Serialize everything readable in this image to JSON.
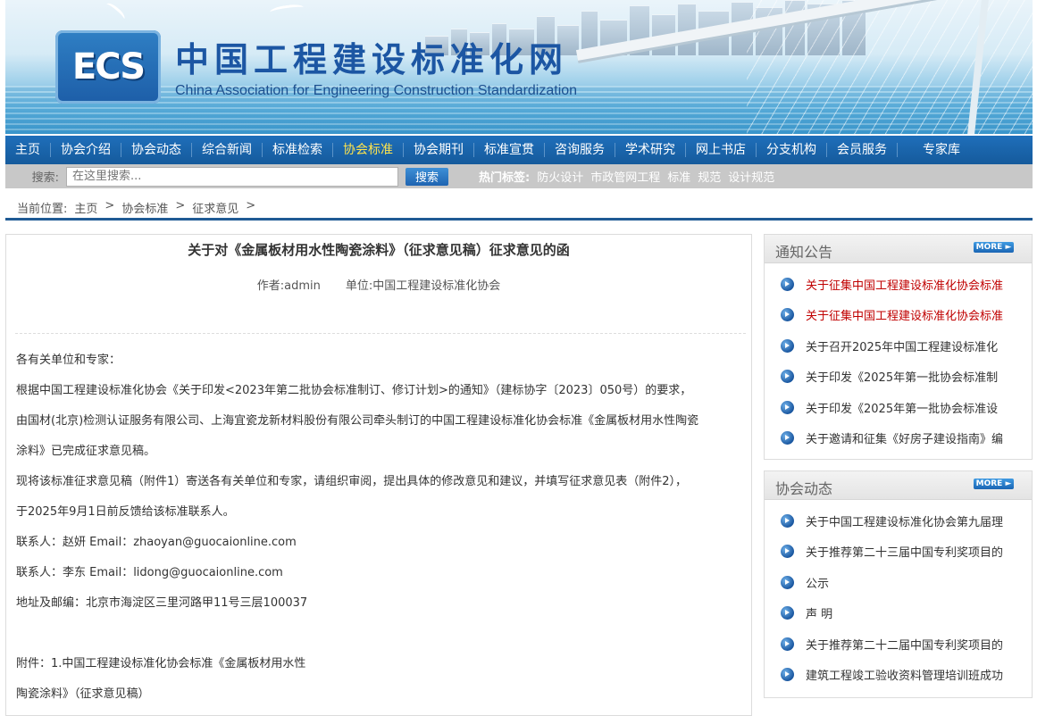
{
  "header": {
    "logo_text": "ECS",
    "site_title": "中国工程建设标准化网",
    "site_subtitle": "China Association for Engineering Construction Standardization"
  },
  "nav": [
    "主页",
    "协会介绍",
    "协会动态",
    "综合新闻",
    "标准检索",
    "协会标准",
    "协会期刊",
    "标准宣贯",
    "咨询服务",
    "学术研究",
    "网上书店",
    "分支机构",
    "会员服务",
    "专家库"
  ],
  "search": {
    "label": "搜索:",
    "placeholder": "在这里搜索...",
    "button": "搜索",
    "hot_label": "热门标签:",
    "hot_tags": [
      "防火设计",
      "市政管网工程",
      "标准",
      "规范",
      "设计规范"
    ]
  },
  "breadcrumb": [
    "当前位置:",
    "主页",
    ">",
    "协会标准",
    ">",
    "征求意见",
    ">"
  ],
  "article": {
    "title": "关于对《金属板材用水性陶瓷涂料》（征求意见稿）征求意见的函",
    "author": "作者:admin",
    "unit": "单位:中国工程建设标准化协会",
    "paragraphs": [
      "各有关单位和专家：",
      "根据中国工程建设标准化协会《关于印发<2023年第二批协会标准制订、修订计划>的通知》（建标协字〔2023〕050号）的要求，",
      "由国材(北京)检测认证服务有限公司、上海宜瓷龙新材料股份有限公司牵头制订的中国工程建设标准化协会标准《金属板材用水性陶瓷",
      "涂料》已完成征求意见稿。",
      "现将该标准征求意见稿（附件1）寄送各有关单位和专家，请组织审阅，提出具体的修改意见和建议，并填写征求意见表（附件2），",
      "于2025年9月1日前反馈给该标准联系人。",
      "联系人：赵妍 Email：zhaoyan@guocaionline.com",
      "联系人：李东  Email：lidong@guocaionline.com",
      "地址及邮编：北京市海淀区三里河路甲11号三层100037",
      "",
      "附件：1.中国工程建设标准化协会标准《金属板材用水性",
      "陶瓷涂料》（征求意见稿）"
    ]
  },
  "sidebar": {
    "notice": {
      "title": "通知公告",
      "more": "MORE",
      "items": [
        {
          "text": "关于征集中国工程建设标准化协会标准",
          "color": "#c00000"
        },
        {
          "text": "关于征集中国工程建设标准化协会标准",
          "color": "#c00000"
        },
        {
          "text": "关于召开2025年中国工程建设标准化",
          "color": "#333333"
        },
        {
          "text": "关于印发《2025年第一批协会标准制",
          "color": "#333333"
        },
        {
          "text": "关于印发《2025年第一批协会标准设",
          "color": "#333333"
        },
        {
          "text": "关于邀请和征集《好房子建设指南》编",
          "color": "#333333"
        }
      ]
    },
    "news": {
      "title": "协会动态",
      "more": "MORE",
      "items": [
        {
          "text": "关于中国工程建设标准化协会第九届理",
          "icon": true
        },
        {
          "text": "关于推荐第二十三届中国专利奖项目的",
          "icon": true
        },
        {
          "text": "公示",
          "icon": true
        },
        {
          "text": "声 明",
          "icon": true
        },
        {
          "text": "关于推荐第二十二届中国专利奖项目的",
          "icon": true
        },
        {
          "text": "建筑工程竣工验收资料管理培训班成功",
          "icon": true
        }
      ]
    }
  }
}
